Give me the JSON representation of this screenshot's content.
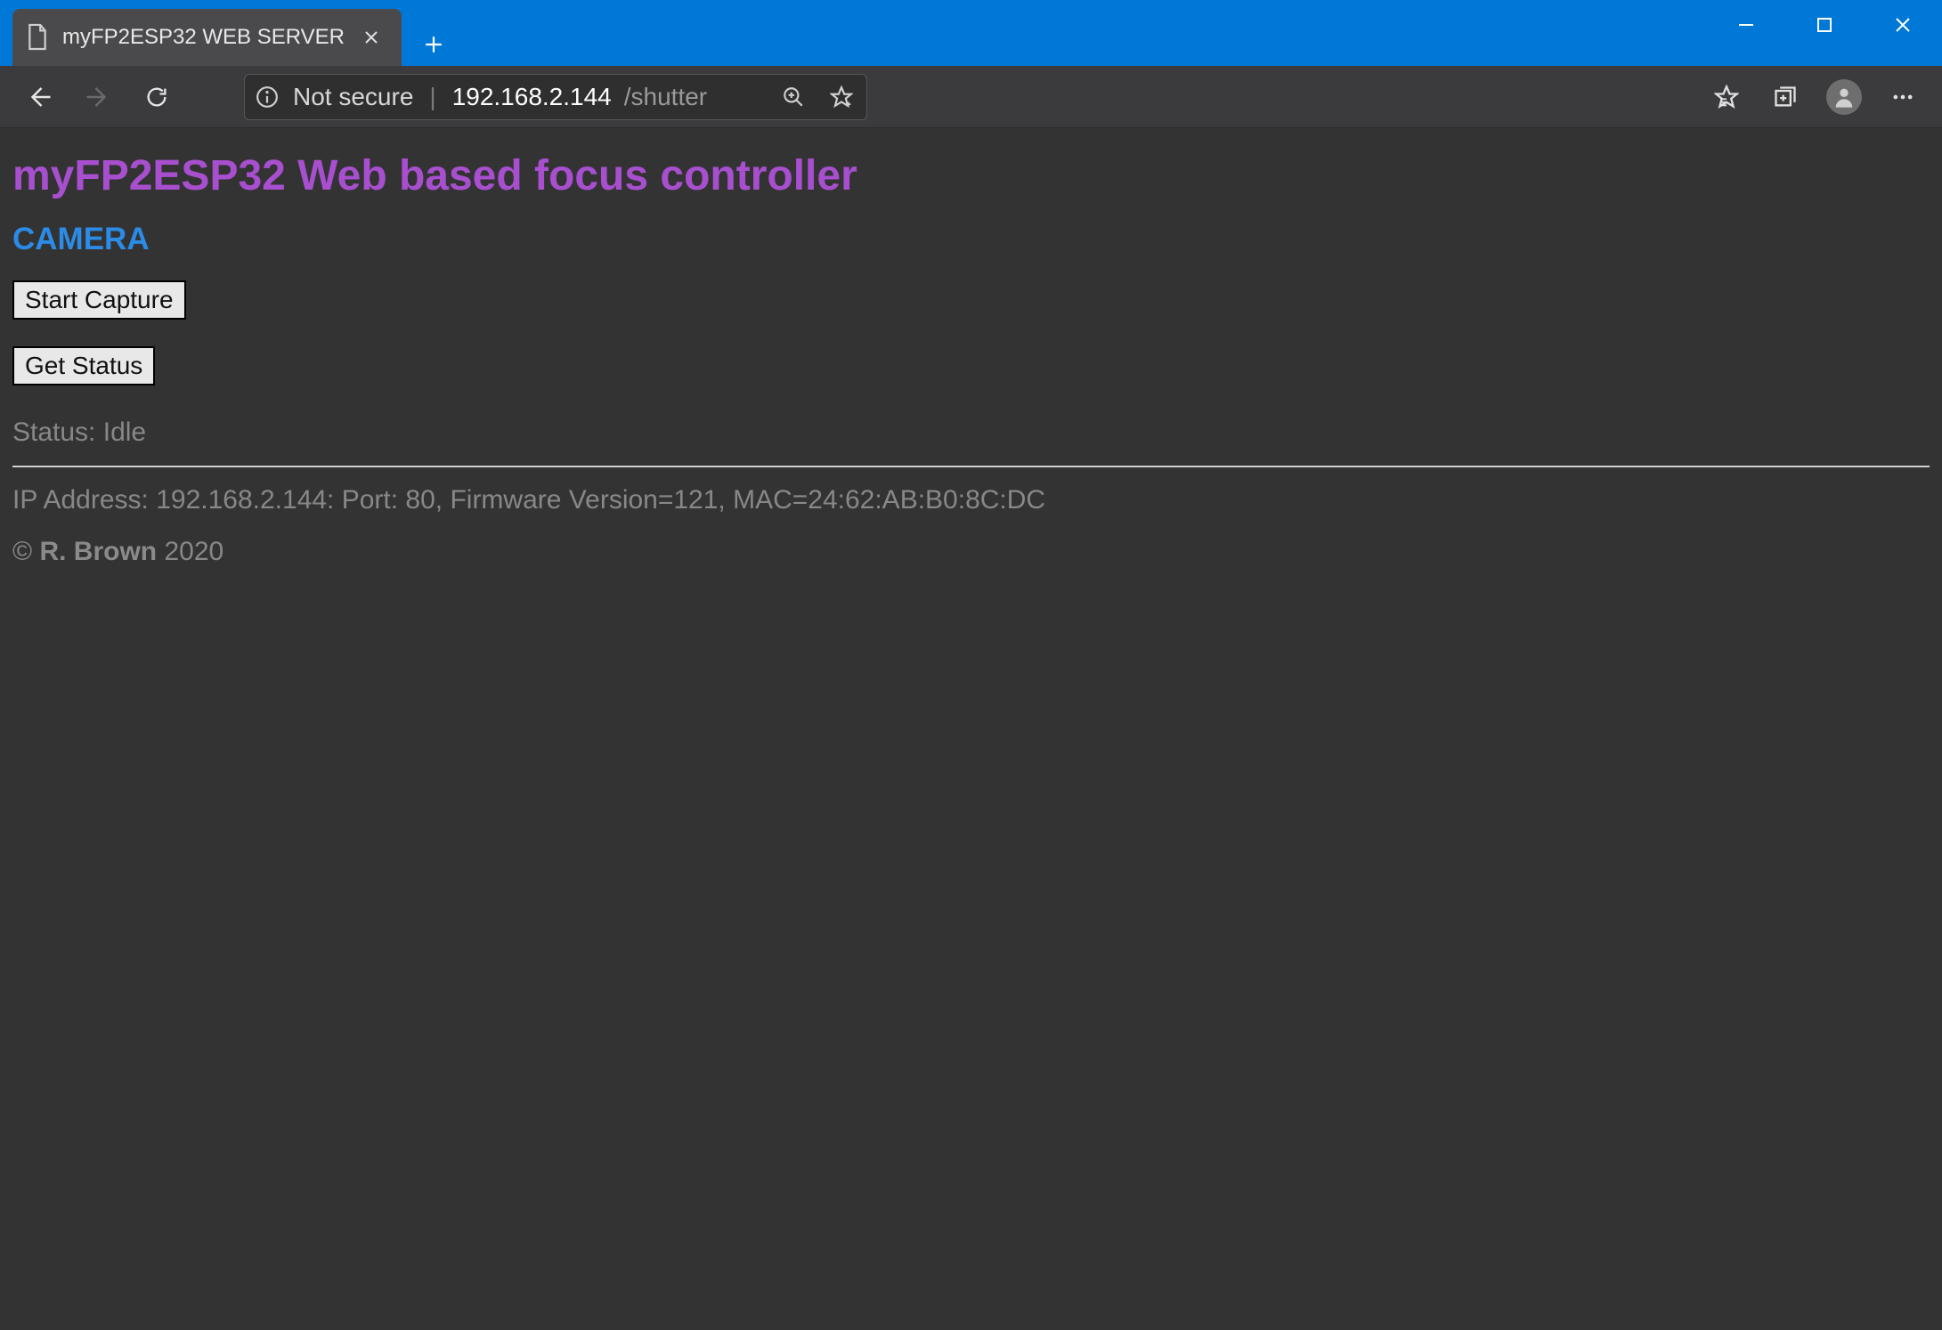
{
  "window": {
    "tab_title": "myFP2ESP32 WEB SERVER"
  },
  "addressbar": {
    "security_label": "Not secure",
    "url_host": "192.168.2.144",
    "url_path": "/shutter"
  },
  "page": {
    "title": "myFP2ESP32 Web based focus controller",
    "section": "CAMERA",
    "buttons": {
      "start_capture": "Start Capture",
      "get_status": "Get Status"
    },
    "status_label": "Status:",
    "status_value": "Idle",
    "footer_info": "IP Address: 192.168.2.144: Port: 80, Firmware Version=121, MAC=24:62:AB:B0:8C:DC",
    "copyright_symbol": "©",
    "copyright_name": "R. Brown",
    "copyright_year": "2020"
  }
}
